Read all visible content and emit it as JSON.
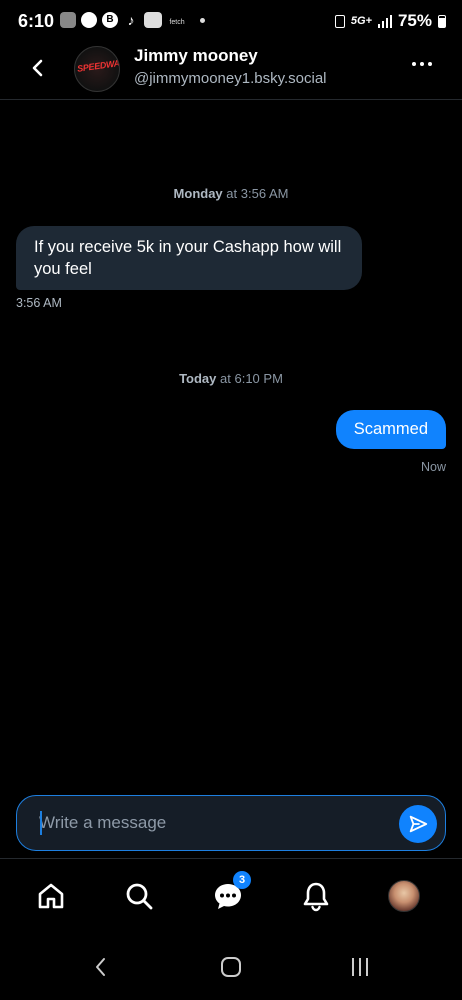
{
  "status_bar": {
    "time": "6:10",
    "icons": [
      "photo-icon",
      "chat-icon",
      "bluesky-icon",
      "tiktok-icon",
      "news-icon",
      "fetch-icon"
    ],
    "fetch_label": "fetch",
    "network": "5G+",
    "battery": "75%"
  },
  "header": {
    "name": "Jimmy mooney",
    "handle": "@jimmymooney1.bsky.social",
    "avatar_text": "SPEEDWAY"
  },
  "conversation": {
    "separator_1": {
      "day": "Monday",
      "time": "at 3:56 AM"
    },
    "incoming_message": "If you receive 5k in your Cashapp how will you feel",
    "incoming_time": "3:56 AM",
    "separator_2": {
      "day": "Today",
      "time": "at 6:10 PM"
    },
    "outgoing_message": "Scammed",
    "outgoing_time": "Now"
  },
  "composer": {
    "placeholder": "Write a message"
  },
  "bottom_nav": {
    "items": [
      "home-icon",
      "search-icon",
      "messages-icon",
      "notifications-icon",
      "profile-avatar"
    ],
    "messages_badge": "3"
  },
  "colors": {
    "background": "#000000",
    "accent": "#1083fe",
    "incoming_bubble": "#1e2935",
    "muted_text": "#aeb8c2"
  }
}
